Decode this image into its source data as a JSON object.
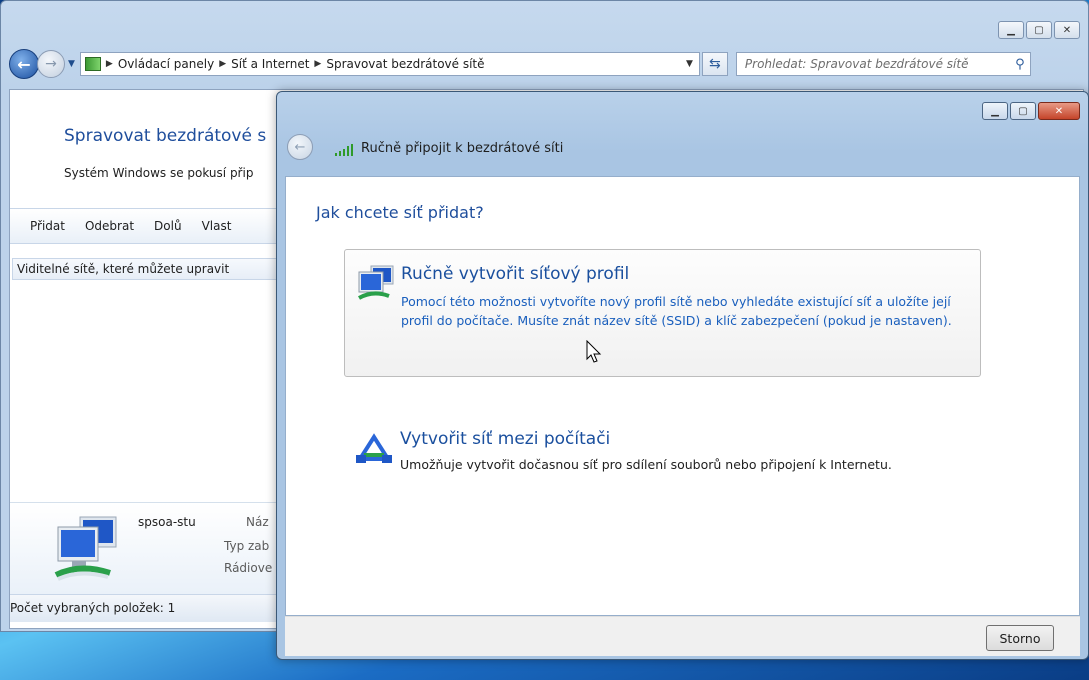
{
  "explorer": {
    "address": {
      "crumbs": [
        "Ovládací panely",
        "Síť a Internet",
        "Spravovat bezdrátové sítě"
      ]
    },
    "search_placeholder": "Prohledat: Spravovat bezdrátové sítě",
    "title": "Spravovat bezdrátové s",
    "subtitle": "Systém Windows se pokusí přip",
    "toolbar": [
      "Přidat",
      "Odebrat",
      "Dolů",
      "Vlast"
    ],
    "list_header": "Viditelné sítě, které můžete upravit",
    "details": {
      "network_name": "spsoa-stu",
      "col1": "Náz",
      "col2": "Typ zab",
      "col3": "Rádiove"
    },
    "status": "Počet vybraných položek: 1"
  },
  "dialog": {
    "title": "Ručně připojit k bezdrátové síti",
    "question": "Jak chcete síť přidat?",
    "options": [
      {
        "title": "Ručně vytvořit síťový profil",
        "description": "Pomocí této možnosti vytvoříte nový profil sítě nebo vyhledáte existující síť a uložíte její profil do počítače. Musíte znát název sítě (SSID) a klíč zabezpečení (pokud je nastaven)."
      },
      {
        "title": "Vytvořit síť mezi počítači",
        "description": "Umožňuje vytvořit dočasnou síť pro sdílení souborů nebo připojení k Internetu."
      }
    ],
    "cancel_label": "Storno"
  },
  "icons": {
    "back": "back-arrow-icon",
    "forward": "forward-arrow-icon",
    "refresh": "refresh-icon",
    "search": "search-icon",
    "minimize": "minimize-icon",
    "maximize": "maximize-icon",
    "close": "close-icon",
    "signal": "wireless-signal-icon",
    "network": "wireless-network-computer-icon",
    "adhoc": "adhoc-network-icon",
    "cursor": "mouse-pointer-icon"
  },
  "colors": {
    "link_blue": "#1a4f9e",
    "description_blue": "#1a5fbd",
    "close_red": "#c4442a"
  }
}
